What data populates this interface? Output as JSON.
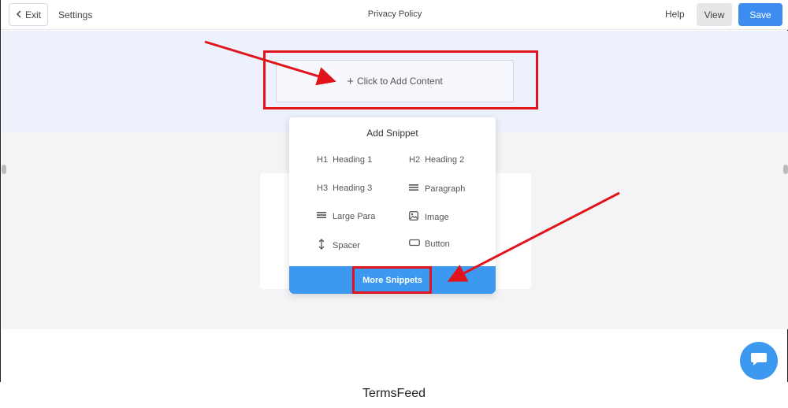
{
  "topbar": {
    "exit_label": "Exit",
    "settings_label": "Settings",
    "page_title": "Privacy Policy",
    "help_label": "Help",
    "view_label": "View",
    "save_label": "Save"
  },
  "editor": {
    "add_content_label": "Click to Add Content"
  },
  "snippet_popup": {
    "title": "Add Snippet",
    "items": [
      {
        "icon_text": "H1",
        "label": "Heading 1"
      },
      {
        "icon_text": "H2",
        "label": "Heading 2"
      },
      {
        "icon_text": "H3",
        "label": "Heading 3"
      },
      {
        "icon_text": "",
        "label": "Paragraph"
      },
      {
        "icon_text": "",
        "label": "Large Para"
      },
      {
        "icon_text": "",
        "label": "Image"
      },
      {
        "icon_text": "",
        "label": "Spacer"
      },
      {
        "icon_text": "",
        "label": "Button"
      }
    ],
    "more_label": "More Snippets"
  },
  "footer": {
    "brand": "TermsFeed"
  },
  "colors": {
    "accent": "#3d8df0",
    "annotation_red": "#e0141a"
  }
}
